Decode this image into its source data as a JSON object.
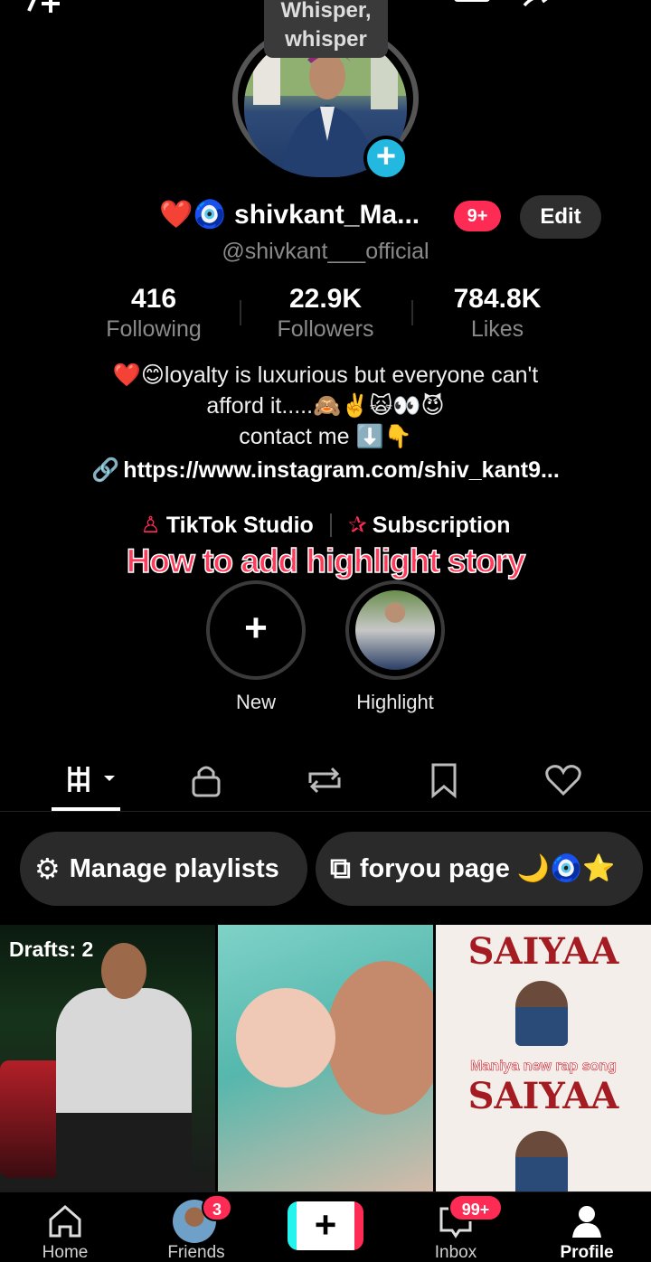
{
  "header": {
    "tooltip": "Whisper, whisper",
    "top_left_icon": "add-friend-icon",
    "top_right_icons": [
      "footprints-icon",
      "share-icon",
      "menu-icon"
    ]
  },
  "profile": {
    "display_name": "❤️🧿 shivkant_Ma...",
    "notification_count": "9+",
    "edit_label": "Edit",
    "handle": "@shivkant___official"
  },
  "stats": [
    {
      "value": "416",
      "label": "Following"
    },
    {
      "value": "22.9K",
      "label": "Followers"
    },
    {
      "value": "784.8K",
      "label": "Likes"
    }
  ],
  "bio": {
    "line1": "❤️😊loyalty is luxurious but everyone can't",
    "line2": "afford it.....🙈✌️🙀👀😈",
    "line3": "contact me ⬇️👇",
    "link": "https://www.instagram.com/shiv_kant9..."
  },
  "studio": {
    "studio_label": "TikTok Studio",
    "subscription_label": "Subscription"
  },
  "overlay_title": "How to add highlight story",
  "highlights": [
    {
      "label": "New"
    },
    {
      "label": "Highlight"
    }
  ],
  "tabs": [
    "videos-grid-icon",
    "lock-icon",
    "repost-icon",
    "bookmark-icon",
    "heart-icon"
  ],
  "chips": {
    "manage": "Manage playlists",
    "foryou": "foryou page 🌙🧿⭐"
  },
  "grid": {
    "drafts": "Drafts: 2",
    "cell3_title": "SAIYAA",
    "cell3_sub": "Maniya new rap song"
  },
  "bottom_nav": [
    {
      "label": "Home"
    },
    {
      "label": "Friends",
      "badge": "3"
    },
    {
      "label": ""
    },
    {
      "label": "Inbox",
      "badge": "99+"
    },
    {
      "label": "Profile"
    }
  ],
  "colors": {
    "accent": "#fe2c55",
    "cyan": "#25f4ee",
    "background": "#000000"
  }
}
